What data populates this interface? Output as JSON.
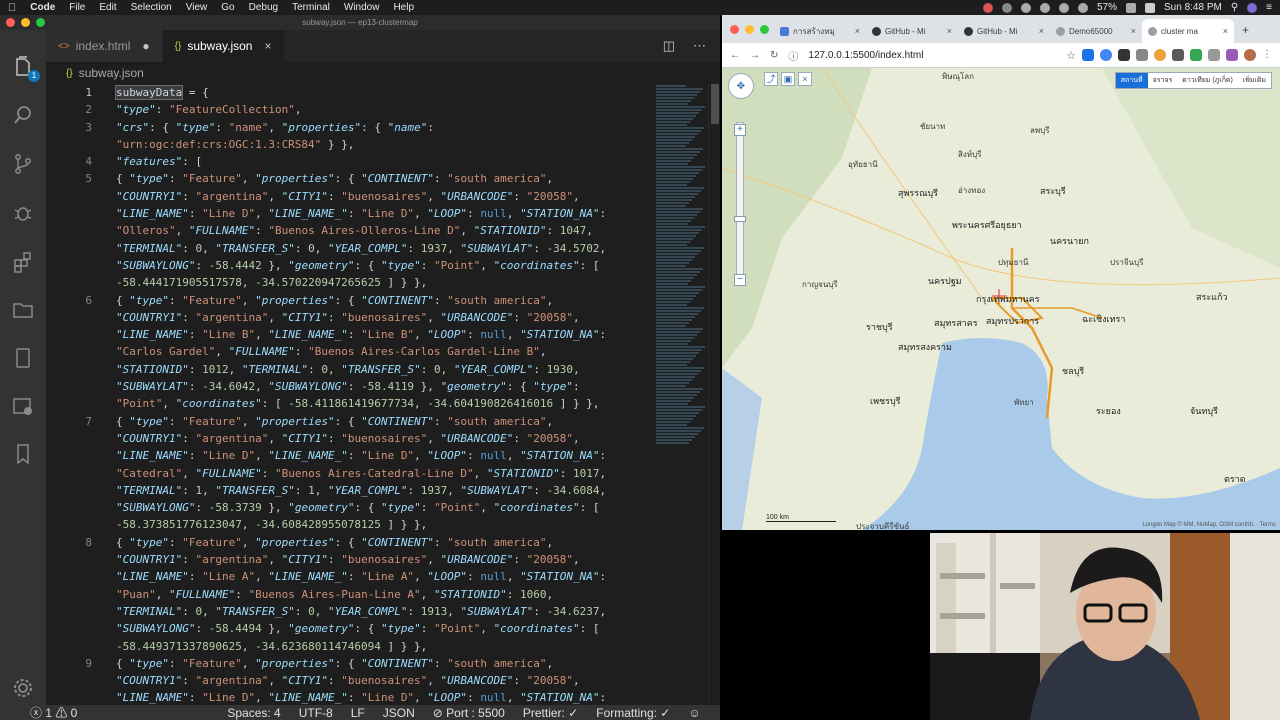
{
  "menubar": {
    "apple": "",
    "items": [
      "Code",
      "File",
      "Edit",
      "Selection",
      "View",
      "Go",
      "Debug",
      "Terminal",
      "Window",
      "Help"
    ],
    "battery": "57%",
    "clock": "Sun 8:48 PM"
  },
  "vscode": {
    "window_title": "subway.json — ep13-clustermap",
    "explorer_badge": "1",
    "tabs": [
      {
        "label": "index.html",
        "icon": "<>",
        "dirty_marker": "●"
      },
      {
        "label": "subway.json",
        "icon": "{}",
        "close": "×"
      }
    ],
    "breadcrumb": {
      "icon": "{}",
      "label": "subway.json"
    },
    "status": {
      "problems": "ⓧ 1 ⚠ 0",
      "spaces": "Spaces: 4",
      "encoding": "UTF-8",
      "eol": "LF",
      "language": "JSON",
      "port": "⊘ Port : 5500",
      "prettier": "Prettier: ✓",
      "formatting": "Formatting: ✓"
    },
    "lines": [
      {
        "num": "1",
        "html": "<span class=\"hl p\">subwayData</span><span class=\"p\"> = {</span>"
      },
      {
        "num": "2",
        "html": "<span class=\"k\">\"type\"</span><span class=\"p\">: </span><span class=\"s\">\"FeatureCollection\"</span><span class=\"p\">,</span>"
      },
      {
        "num": "3",
        "html": "<span class=\"k\">\"crs\"</span><span class=\"p\">: { </span><span class=\"k\">\"type\"</span><span class=\"p\">: </span><span class=\"s\">\"name\"</span><span class=\"p\">, </span><span class=\"k\">\"properties\"</span><span class=\"p\">: { </span><span class=\"k\">\"name\"</span><span class=\"p\">:</span>"
      },
      {
        "num": "",
        "html": "<span class=\"s\">\"urn:ogc:def:crs:OGC:1.3:CRS84\"</span><span class=\"p\"> } },</span>"
      },
      {
        "num": "4",
        "html": "<span class=\"k\">\"features\"</span><span class=\"p\">: [</span>"
      },
      {
        "num": "5",
        "html": "<span class=\"p\">{ </span><span class=\"k\">\"type\"</span><span class=\"p\">: </span><span class=\"s\">\"Feature\"</span><span class=\"p\">, </span><span class=\"k\">\"properties\"</span><span class=\"p\">: { </span><span class=\"k\">\"CONTINENT\"</span><span class=\"p\">: </span><span class=\"s\">\"south america\"</span><span class=\"p\">,</span>"
      },
      {
        "num": "",
        "html": "<span class=\"k\">\"COUNTRY1\"</span><span class=\"p\">: </span><span class=\"s\">\"argentina\"</span><span class=\"p\">, </span><span class=\"k\">\"CITY1\"</span><span class=\"p\">: </span><span class=\"s\">\"buenosaires\"</span><span class=\"p\">, </span><span class=\"k\">\"URBANCODE\"</span><span class=\"p\">: </span><span class=\"s\">\"20058\"</span><span class=\"p\">,</span>"
      },
      {
        "num": "",
        "html": "<span class=\"k\">\"LINE_NAME\"</span><span class=\"p\">: </span><span class=\"s\">\"Line D\"</span><span class=\"p\">, </span><span class=\"k\">\"LINE_NAME_\"</span><span class=\"p\">: </span><span class=\"s\">\"Line D\"</span><span class=\"p\">, </span><span class=\"k\">\"LOOP\"</span><span class=\"p\">: </span><span class=\"kw\">null</span><span class=\"p\">, </span><span class=\"k\">\"STATION_NA\"</span><span class=\"p\">:</span>"
      },
      {
        "num": "",
        "html": "<span class=\"s\">\"Olleros\"</span><span class=\"p\">, </span><span class=\"k\">\"FULLNAME\"</span><span class=\"p\">: </span><span class=\"s\">\"Buenos Aires-Olleros-Line D\"</span><span class=\"p\">, </span><span class=\"k\">\"STATIONID\"</span><span class=\"p\">: </span><span class=\"n\">1047</span><span class=\"p\">,</span>"
      },
      {
        "num": "",
        "html": "<span class=\"k\">\"TERMINAL\"</span><span class=\"p\">: </span><span class=\"n\">0</span><span class=\"p\">, </span><span class=\"k\">\"TRANSFER_S\"</span><span class=\"p\">: </span><span class=\"n\">0</span><span class=\"p\">, </span><span class=\"k\">\"YEAR_COMPL\"</span><span class=\"p\">: </span><span class=\"n\">1937</span><span class=\"p\">, </span><span class=\"k\">\"SUBWAYLAT\"</span><span class=\"p\">: </span><span class=\"n\">-34.5702</span><span class=\"p\">,</span>"
      },
      {
        "num": "",
        "html": "<span class=\"k\">\"SUBWAYLONG\"</span><span class=\"p\">: </span><span class=\"n\">-58.4442</span><span class=\"p\"> }, </span><span class=\"k\">\"geometry\"</span><span class=\"p\">: { </span><span class=\"k\">\"type\"</span><span class=\"p\">: </span><span class=\"s\">\"Point\"</span><span class=\"p\">, </span><span class=\"k\">\"coordinates\"</span><span class=\"p\">: [</span>"
      },
      {
        "num": "",
        "html": "<span class=\"n\">-58.444171905517578</span><span class=\"p\">, </span><span class=\"n\">-34.570220947265625</span><span class=\"p\"> ] } },</span>"
      },
      {
        "num": "6",
        "html": "<span class=\"p\">{ </span><span class=\"k\">\"type\"</span><span class=\"p\">: </span><span class=\"s\">\"Feature\"</span><span class=\"p\">, </span><span class=\"k\">\"properties\"</span><span class=\"p\">: { </span><span class=\"k\">\"CONTINENT\"</span><span class=\"p\">: </span><span class=\"s\">\"south america\"</span><span class=\"p\">,</span>"
      },
      {
        "num": "",
        "html": "<span class=\"k\">\"COUNTRY1\"</span><span class=\"p\">: </span><span class=\"s\">\"argentina\"</span><span class=\"p\">, </span><span class=\"k\">\"CITY1\"</span><span class=\"p\">: </span><span class=\"s\">\"buenosaires\"</span><span class=\"p\">, </span><span class=\"k\">\"URBANCODE\"</span><span class=\"p\">: </span><span class=\"s\">\"20058\"</span><span class=\"p\">,</span>"
      },
      {
        "num": "",
        "html": "<span class=\"k\">\"LINE_NAME\"</span><span class=\"p\">: </span><span class=\"s\">\"Line B\"</span><span class=\"p\">, </span><span class=\"k\">\"LINE_NAME_\"</span><span class=\"p\">: </span><span class=\"s\">\"Line B\"</span><span class=\"p\">, </span><span class=\"k\">\"LOOP\"</span><span class=\"p\">: </span><span class=\"kw\">null</span><span class=\"p\">, </span><span class=\"k\">\"STATION_NA\"</span><span class=\"p\">:</span>"
      },
      {
        "num": "",
        "html": "<span class=\"s\">\"Carlos Gardel\"</span><span class=\"p\">, </span><span class=\"k\">\"FULLNAME\"</span><span class=\"p\">: </span><span class=\"s\">\"Buenos Aires-Carlos Gardel-Line B\"</span><span class=\"p\">,</span>"
      },
      {
        "num": "",
        "html": "<span class=\"k\">\"STATIONID\"</span><span class=\"p\">: </span><span class=\"n\">1012</span><span class=\"p\">, </span><span class=\"k\">\"TERMINAL\"</span><span class=\"p\">: </span><span class=\"n\">0</span><span class=\"p\">, </span><span class=\"k\">\"TRANSFER_S\"</span><span class=\"p\">: </span><span class=\"n\">0</span><span class=\"p\">, </span><span class=\"k\">\"YEAR_COMPL\"</span><span class=\"p\">: </span><span class=\"n\">1930</span><span class=\"p\">,</span>"
      },
      {
        "num": "",
        "html": "<span class=\"k\">\"SUBWAYLAT\"</span><span class=\"p\">: </span><span class=\"n\">-34.6042</span><span class=\"p\">, </span><span class=\"k\">\"SUBWAYLONG\"</span><span class=\"p\">: </span><span class=\"n\">-58.4119</span><span class=\"p\"> }, </span><span class=\"k\">\"geometry\"</span><span class=\"p\">: { </span><span class=\"k\">\"type\"</span><span class=\"p\">:</span>"
      },
      {
        "num": "",
        "html": "<span class=\"s\">\"Point\"</span><span class=\"p\">, </span><span class=\"k\">\"coordinates\"</span><span class=\"p\">: [ </span><span class=\"n\">-58.411861419677734</span><span class=\"p\">, </span><span class=\"n\">-34.604190826416016</span><span class=\"p\"> ] } },</span>"
      },
      {
        "num": "7",
        "html": "<span class=\"p\">{ </span><span class=\"k\">\"type\"</span><span class=\"p\">: </span><span class=\"s\">\"Feature\"</span><span class=\"p\">, </span><span class=\"k\">\"properties\"</span><span class=\"p\">: { </span><span class=\"k\">\"CONTINENT\"</span><span class=\"p\">: </span><span class=\"s\">\"south america\"</span><span class=\"p\">,</span>"
      },
      {
        "num": "",
        "html": "<span class=\"k\">\"COUNTRY1\"</span><span class=\"p\">: </span><span class=\"s\">\"argentina\"</span><span class=\"p\">, </span><span class=\"k\">\"CITY1\"</span><span class=\"p\">: </span><span class=\"s\">\"buenosaires\"</span><span class=\"p\">, </span><span class=\"k\">\"URBANCODE\"</span><span class=\"p\">: </span><span class=\"s\">\"20058\"</span><span class=\"p\">,</span>"
      },
      {
        "num": "",
        "html": "<span class=\"k\">\"LINE_NAME\"</span><span class=\"p\">: </span><span class=\"s\">\"Line D\"</span><span class=\"p\">, </span><span class=\"k\">\"LINE_NAME_\"</span><span class=\"p\">: </span><span class=\"s\">\"Line D\"</span><span class=\"p\">, </span><span class=\"k\">\"LOOP\"</span><span class=\"p\">: </span><span class=\"kw\">null</span><span class=\"p\">, </span><span class=\"k\">\"STATION_NA\"</span><span class=\"p\">:</span>"
      },
      {
        "num": "",
        "html": "<span class=\"s\">\"Catedral\"</span><span class=\"p\">, </span><span class=\"k\">\"FULLNAME\"</span><span class=\"p\">: </span><span class=\"s\">\"Buenos Aires-Catedral-Line D\"</span><span class=\"p\">, </span><span class=\"k\">\"STATIONID\"</span><span class=\"p\">: </span><span class=\"n\">1017</span><span class=\"p\">,</span>"
      },
      {
        "num": "",
        "html": "<span class=\"k\">\"TERMINAL\"</span><span class=\"p\">: </span><span class=\"n\">1</span><span class=\"p\">, </span><span class=\"k\">\"TRANSFER_S\"</span><span class=\"p\">: </span><span class=\"n\">1</span><span class=\"p\">, </span><span class=\"k\">\"YEAR_COMPL\"</span><span class=\"p\">: </span><span class=\"n\">1937</span><span class=\"p\">, </span><span class=\"k\">\"SUBWAYLAT\"</span><span class=\"p\">: </span><span class=\"n\">-34.6084</span><span class=\"p\">,</span>"
      },
      {
        "num": "",
        "html": "<span class=\"k\">\"SUBWAYLONG\"</span><span class=\"p\">: </span><span class=\"n\">-58.3739</span><span class=\"p\"> }, </span><span class=\"k\">\"geometry\"</span><span class=\"p\">: { </span><span class=\"k\">\"type\"</span><span class=\"p\">: </span><span class=\"s\">\"Point\"</span><span class=\"p\">, </span><span class=\"k\">\"coordinates\"</span><span class=\"p\">: [</span>"
      },
      {
        "num": "",
        "html": "<span class=\"n\">-58.373851776123047</span><span class=\"p\">, </span><span class=\"n\">-34.608428955078125</span><span class=\"p\"> ] } },</span>"
      },
      {
        "num": "8",
        "html": "<span class=\"p\">{ </span><span class=\"k\">\"type\"</span><span class=\"p\">: </span><span class=\"s\">\"Feature\"</span><span class=\"p\">, </span><span class=\"k\">\"properties\"</span><span class=\"p\">: { </span><span class=\"k\">\"CONTINENT\"</span><span class=\"p\">: </span><span class=\"s\">\"south america\"</span><span class=\"p\">,</span>"
      },
      {
        "num": "",
        "html": "<span class=\"k\">\"COUNTRY1\"</span><span class=\"p\">: </span><span class=\"s\">\"argentina\"</span><span class=\"p\">, </span><span class=\"k\">\"CITY1\"</span><span class=\"p\">: </span><span class=\"s\">\"buenosaires\"</span><span class=\"p\">, </span><span class=\"k\">\"URBANCODE\"</span><span class=\"p\">: </span><span class=\"s\">\"20058\"</span><span class=\"p\">,</span>"
      },
      {
        "num": "",
        "html": "<span class=\"k\">\"LINE_NAME\"</span><span class=\"p\">: </span><span class=\"s\">\"Line A\"</span><span class=\"p\">, </span><span class=\"k\">\"LINE_NAME_\"</span><span class=\"p\">: </span><span class=\"s\">\"Line A\"</span><span class=\"p\">, </span><span class=\"k\">\"LOOP\"</span><span class=\"p\">: </span><span class=\"kw\">null</span><span class=\"p\">, </span><span class=\"k\">\"STATION_NA\"</span><span class=\"p\">:</span>"
      },
      {
        "num": "",
        "html": "<span class=\"s\">\"Puan\"</span><span class=\"p\">, </span><span class=\"k\">\"FULLNAME\"</span><span class=\"p\">: </span><span class=\"s\">\"Buenos Aires-Puan-Line A\"</span><span class=\"p\">, </span><span class=\"k\">\"STATIONID\"</span><span class=\"p\">: </span><span class=\"n\">1060</span><span class=\"p\">,</span>"
      },
      {
        "num": "",
        "html": "<span class=\"k\">\"TERMINAL\"</span><span class=\"p\">: </span><span class=\"n\">0</span><span class=\"p\">, </span><span class=\"k\">\"TRANSFER_S\"</span><span class=\"p\">: </span><span class=\"n\">0</span><span class=\"p\">, </span><span class=\"k\">\"YEAR_COMPL\"</span><span class=\"p\">: </span><span class=\"n\">1913</span><span class=\"p\">, </span><span class=\"k\">\"SUBWAYLAT\"</span><span class=\"p\">: </span><span class=\"n\">-34.6237</span><span class=\"p\">,</span>"
      },
      {
        "num": "",
        "html": "<span class=\"k\">\"SUBWAYLONG\"</span><span class=\"p\">: </span><span class=\"n\">-58.4494</span><span class=\"p\"> }, </span><span class=\"k\">\"geometry\"</span><span class=\"p\">: { </span><span class=\"k\">\"type\"</span><span class=\"p\">: </span><span class=\"s\">\"Point\"</span><span class=\"p\">, </span><span class=\"k\">\"coordinates\"</span><span class=\"p\">: [</span>"
      },
      {
        "num": "",
        "html": "<span class=\"n\">-58.449371337890625</span><span class=\"p\">, </span><span class=\"n\">-34.623680114746094</span><span class=\"p\"> ] } },</span>"
      },
      {
        "num": "9",
        "html": "<span class=\"p\">{ </span><span class=\"k\">\"type\"</span><span class=\"p\">: </span><span class=\"s\">\"Feature\"</span><span class=\"p\">, </span><span class=\"k\">\"properties\"</span><span class=\"p\">: { </span><span class=\"k\">\"CONTINENT\"</span><span class=\"p\">: </span><span class=\"s\">\"south america\"</span><span class=\"p\">,</span>"
      },
      {
        "num": "",
        "html": "<span class=\"k\">\"COUNTRY1\"</span><span class=\"p\">: </span><span class=\"s\">\"argentina\"</span><span class=\"p\">, </span><span class=\"k\">\"CITY1\"</span><span class=\"p\">: </span><span class=\"s\">\"buenosaires\"</span><span class=\"p\">, </span><span class=\"k\">\"URBANCODE\"</span><span class=\"p\">: </span><span class=\"s\">\"20058\"</span><span class=\"p\">,</span>"
      },
      {
        "num": "",
        "html": "<span class=\"k\">\"LINE_NAME\"</span><span class=\"p\">: </span><span class=\"s\">\"Line D\"</span><span class=\"p\">, </span><span class=\"k\">\"LINE_NAME_\"</span><span class=\"p\">: </span><span class=\"s\">\"Line D\"</span><span class=\"p\">, </span><span class=\"k\">\"LOOP\"</span><span class=\"p\">: </span><span class=\"kw\">null</span><span class=\"p\">, </span><span class=\"k\">\"STATION_NA\"</span><span class=\"p\">:</span>"
      }
    ]
  },
  "chrome": {
    "tabs": [
      {
        "label": "การสร้างหมุ",
        "close": "×",
        "color": "#4a7bd8"
      },
      {
        "label": "GitHub - Mi",
        "close": "×",
        "color": "#333333"
      },
      {
        "label": "GitHub - Mi",
        "close": "×",
        "color": "#333333"
      },
      {
        "label": "Demo65000",
        "close": "×",
        "color": "#9aa0a6"
      },
      {
        "label": "cluster ma",
        "close": "×",
        "color": "#9aa0a6"
      }
    ],
    "new_tab": "+",
    "url": "127.0.0.1:5500/index.html",
    "map": {
      "layers": [
        "สถานที่",
        "จราจร",
        "ดาวเทียม (ภูเก็ต)",
        "เพิ่มเติม"
      ],
      "scale": "100 km",
      "attribution": "Longdo Map © MM, NuMap, OSM contrib. · Terms",
      "places": [
        {
          "name": "พิษณุโลก"
        },
        {
          "name": "ชัยนาท"
        },
        {
          "name": "ลพบุรี"
        },
        {
          "name": "สิงห์บุรี"
        },
        {
          "name": "อุทัยธานี"
        },
        {
          "name": "สุพรรณบุรี"
        },
        {
          "name": "อ่างทอง"
        },
        {
          "name": "สระบุรี"
        },
        {
          "name": "พระนครศรีอยุธยา"
        },
        {
          "name": "นครนายก"
        },
        {
          "name": "ปทุมธานี"
        },
        {
          "name": "ปราจีนบุรี"
        },
        {
          "name": "นครปฐม"
        },
        {
          "name": "กรุงเทพมหานคร"
        },
        {
          "name": "ฉะเชิงเทรา"
        },
        {
          "name": "สระแก้ว"
        },
        {
          "name": "ราชบุรี"
        },
        {
          "name": "สมุทรปราการ"
        },
        {
          "name": "สมุทรสาคร"
        },
        {
          "name": "สมุทรสงคราม"
        },
        {
          "name": "ชลบุรี"
        },
        {
          "name": "เพชรบุรี"
        },
        {
          "name": "ระยอง"
        },
        {
          "name": "จันทบุรี"
        },
        {
          "name": "ตราด"
        },
        {
          "name": "ประจวบคีรีขันธ์"
        },
        {
          "name": "กาญจนบุรี"
        },
        {
          "name": "พัทยา"
        }
      ]
    }
  }
}
